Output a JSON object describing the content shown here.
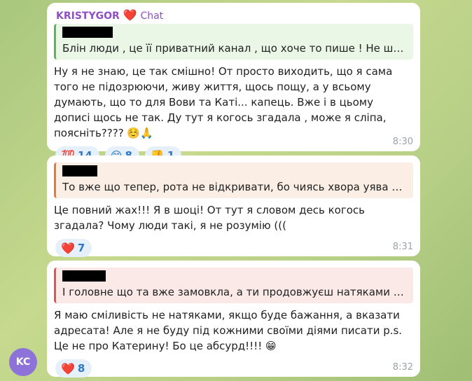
{
  "messages": [
    {
      "sender": "KRISTYGOR",
      "heart": "❤️",
      "chat_tag": "Chat",
      "reply_text": "Блін люди , це її приватний канал , що хоче то пише ! Не шукайте себе",
      "text": "Ну я не знаю, це так смішно! От просто виходить, що я сама того не підозрюючи, живу життя, щось пощу, а у всьому думають, що то для Вови та Каті... капець. Вже і в цьому дописі щось не так. Ду тут я когось згадала , може я сліпа, поясніть???? ☺️🙏",
      "reactions": [
        {
          "emoji": "💯",
          "count": "14"
        },
        {
          "emoji": "😁",
          "count": "8"
        },
        {
          "emoji": "👎",
          "count": "1"
        }
      ],
      "time": "8:30"
    },
    {
      "reply_text": "То вже що тепер, рота не відкривати, бо чиясь хвора уява спрацювала",
      "text": "Це повний жах!!! Я в шоці! От тут я словом десь когось згадала? Чому люди такі, я не розумію (((",
      "reactions": [
        {
          "emoji": "❤️",
          "count": "7"
        }
      ],
      "time": "8:31"
    },
    {
      "reply_text": "І головне що та вже замовкла, а ти продовжуєш натяками все писати",
      "text": "Я маю сміливість не натяками, якщо буде бажання, а вказати адресата! Але я не буду під кожними своїми діями писати p.s. Це не про Катерину! Бо це абсурд!!!! 😁",
      "reactions": [
        {
          "emoji": "❤️",
          "count": "8"
        }
      ],
      "time": "8:32"
    }
  ],
  "avatar": {
    "initials": "KC",
    "color": "#8d72d9"
  }
}
